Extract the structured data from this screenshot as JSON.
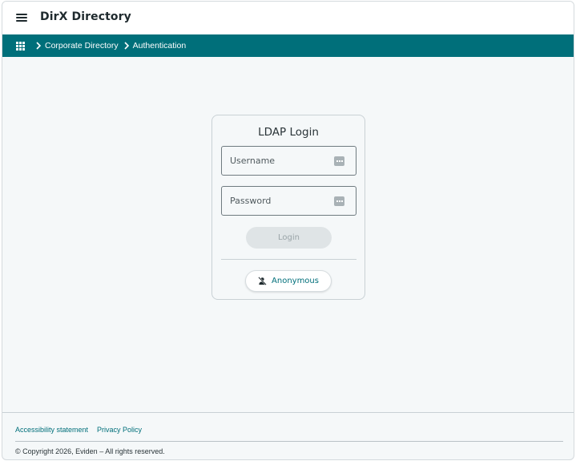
{
  "header": {
    "menu_icon": "hamburger-menu-icon",
    "app_title": "DirX Directory"
  },
  "breadcrumb": {
    "apps_icon": "apps-grid-icon",
    "items": [
      {
        "label": "Corporate Directory"
      },
      {
        "label": "Authentication"
      }
    ]
  },
  "login_card": {
    "title": "LDAP Login",
    "username": {
      "placeholder": "Username",
      "value": "",
      "icon": "password-manager-dots-icon"
    },
    "password": {
      "placeholder": "Password",
      "value": "",
      "icon": "password-manager-dots-icon"
    },
    "login_label": "Login",
    "anonymous_label": "Anonymous",
    "anonymous_icon": "person-off-icon"
  },
  "footer": {
    "links": [
      {
        "label": "Accessibility statement"
      },
      {
        "label": "Privacy Policy"
      }
    ],
    "copyright": "© Copyright 2026, Eviden – All rights reserved."
  },
  "colors": {
    "accent": "#006f7a",
    "page_background": "#f5f8f9",
    "disabled_button": "#dfe4e6"
  }
}
